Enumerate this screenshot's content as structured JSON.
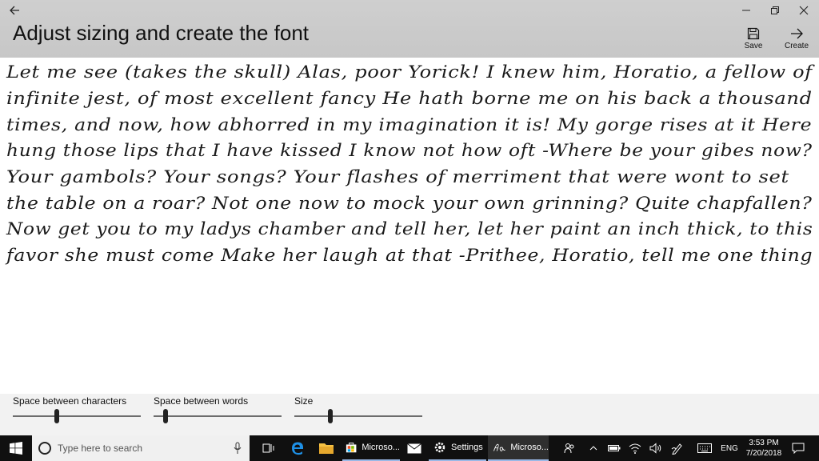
{
  "window": {
    "title": "Adjust sizing and create the font",
    "commands": [
      {
        "label": "Save",
        "icon": "save-icon"
      },
      {
        "label": "Create",
        "icon": "arrow-right-icon"
      }
    ]
  },
  "preview": {
    "lines": [
      "Let me see (takes the skull) Alas, poor Yorick! I knew him, Horatio, a fellow of",
      "infinite jest, of most excellent fancy He hath borne me on his back a thousand",
      "times, and now, how abhorred in my imagination it is! My gorge rises at it Here",
      "hung those lips that I have kissed I know not how oft -Where be your gibes now?",
      "Your gambols? Your songs? Your flashes of merriment that were wont to set",
      "the table on a roar? Not one now to mock your own grinning? Quite chapfallen?",
      "Now get you to my ladys chamber and tell her, let her paint an inch thick, to this",
      "favor she must come Make her laugh at that -Prithee, Horatio, tell me one thing"
    ]
  },
  "sliders": [
    {
      "label": "Space between characters",
      "value": 0.34
    },
    {
      "label": "Space between words",
      "value": 0.08
    },
    {
      "label": "Size",
      "value": 0.27
    }
  ],
  "taskbar": {
    "search_placeholder": "Type here to search",
    "apps": [
      {
        "label": "Microso...",
        "icon": "store-icon"
      },
      {
        "label": "Settings",
        "icon": "gear-icon"
      },
      {
        "label": "Microso...",
        "icon": "font-maker-icon"
      }
    ],
    "language": "ENG",
    "time": "3:53 PM",
    "date": "7/20/2018"
  },
  "colors": {
    "titlebar": "#c9c9c9",
    "taskbar": "#101010",
    "accent": "#9ab8e6"
  }
}
